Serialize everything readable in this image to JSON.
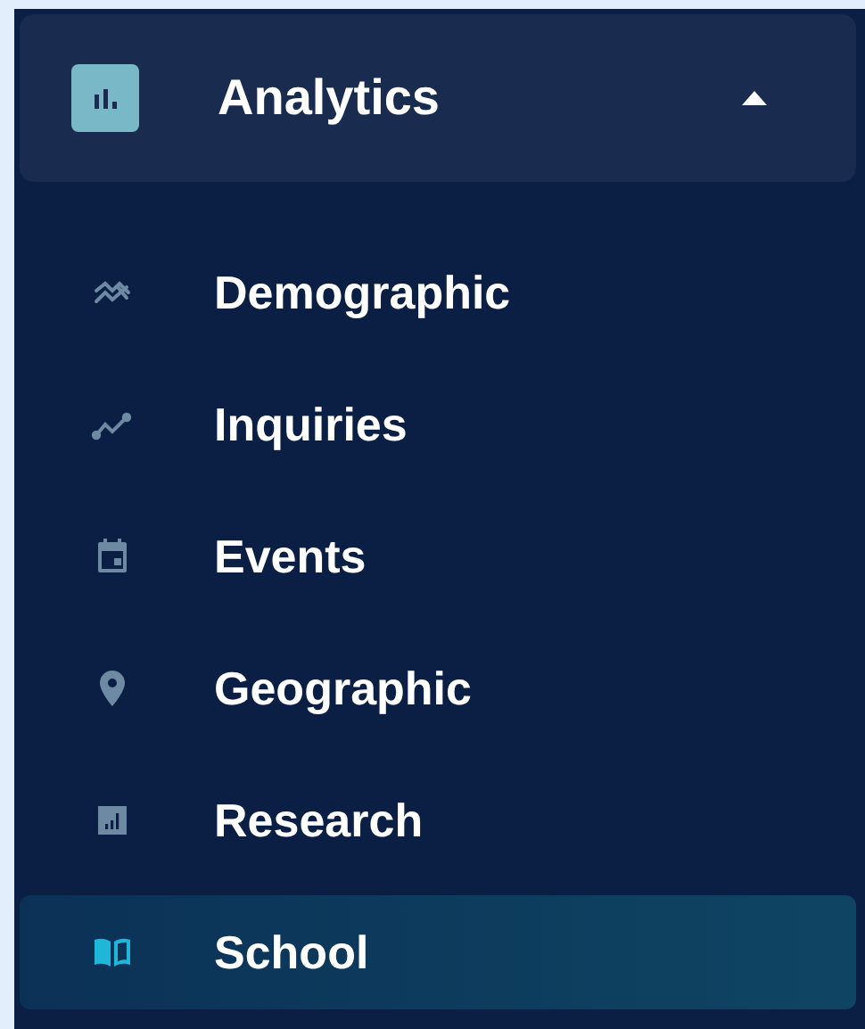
{
  "section": {
    "title": "Analytics",
    "expanded": true
  },
  "items": [
    {
      "label": "Demographic",
      "selected": false
    },
    {
      "label": "Inquiries",
      "selected": false
    },
    {
      "label": "Events",
      "selected": false
    },
    {
      "label": "Geographic",
      "selected": false
    },
    {
      "label": "Research",
      "selected": false
    },
    {
      "label": "School",
      "selected": true
    }
  ]
}
